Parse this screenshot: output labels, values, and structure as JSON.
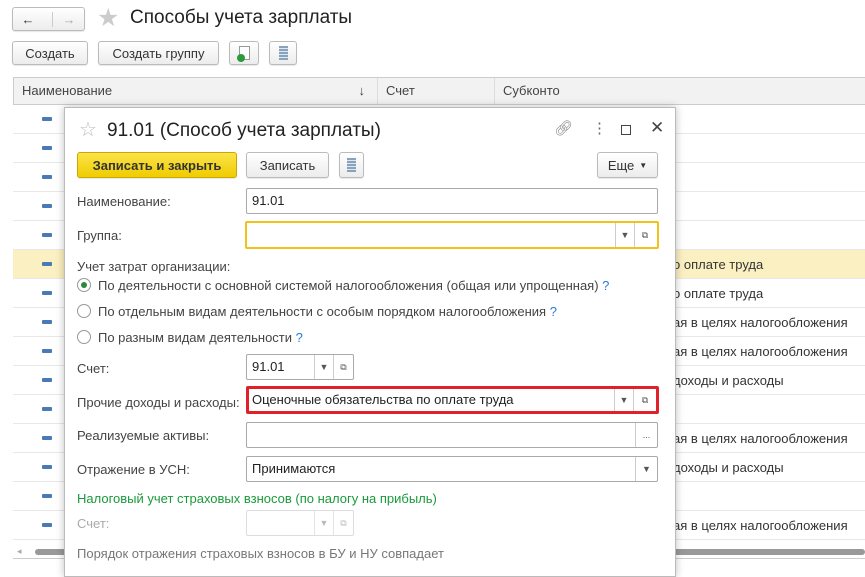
{
  "header": {
    "title": "Способы учета зарплаты",
    "back": "←",
    "forward": "→"
  },
  "toolbar": {
    "create": "Создать",
    "create_group": "Создать группу"
  },
  "table": {
    "columns": [
      "Наименование",
      "Счет",
      "Субконто"
    ],
    "sort_indicator": "↓",
    "rows": [
      "",
      "",
      "",
      "",
      "",
      "о оплате труда",
      "о оплате труда",
      "ая в целях налогообложения",
      "ая в целях налогообложения",
      "доходы и расходы",
      "",
      "ая в целях налогообложения",
      "доходы и расходы",
      "",
      "ая в целях налогообложения"
    ],
    "selected_row": 5
  },
  "modal": {
    "title": "91.01 (Способ учета зарплаты)",
    "save_close": "Записать и закрыть",
    "save": "Записать",
    "more": "Еще",
    "name_label": "Наименование:",
    "name_value": "91.01",
    "group_label": "Группа:",
    "group_value": "",
    "cost_label": "Учет затрат организации:",
    "radios": [
      "По деятельности с основной системой налогообложения (общая или упрощенная)",
      "По отдельным видам деятельности с особым порядком налогообложения",
      "По разным видам деятельности"
    ],
    "radio_selected": 0,
    "help": "?",
    "account_label": "Счет:",
    "account_value": "91.01",
    "other_label": "Прочие доходы и расходы:",
    "other_value": "Оценочные обязательства по оплате труда",
    "assets_label": "Реализуемые активы:",
    "assets_value": "",
    "ellipsis": "...",
    "usn_label": "Отражение в УСН:",
    "usn_value": "Принимаются",
    "tax_section": "Налоговый учет страховых взносов (по налогу на прибыль)",
    "tax_account_label": "Счет:",
    "tax_account_value": "",
    "note": "Порядок отражения страховых взносов в БУ и НУ совпадает"
  },
  "colors": {
    "accent_yellow": "#f5d20a",
    "highlight_red": "#e0212b",
    "section_green": "#1a9a3a",
    "focus": "#f2c21b"
  }
}
